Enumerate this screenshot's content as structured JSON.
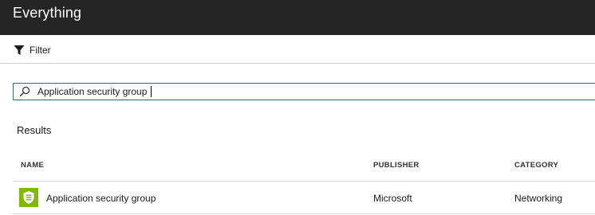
{
  "header": {
    "title": "Everything"
  },
  "toolbar": {
    "filter_label": "Filter",
    "filter_icon": "filter-icon"
  },
  "search": {
    "value": "Application security group",
    "icon": "search-icon",
    "border_color": "#2f6d79"
  },
  "results": {
    "heading": "Results",
    "columns": [
      "NAME",
      "PUBLISHER",
      "CATEGORY"
    ],
    "rows": [
      {
        "icon": "application-security-group-icon",
        "icon_color": "#7fba00",
        "name": "Application security group",
        "publisher": "Microsoft",
        "category": "Networking"
      }
    ]
  },
  "colors": {
    "header_bg": "#252525",
    "header_text": "#ffffff"
  }
}
